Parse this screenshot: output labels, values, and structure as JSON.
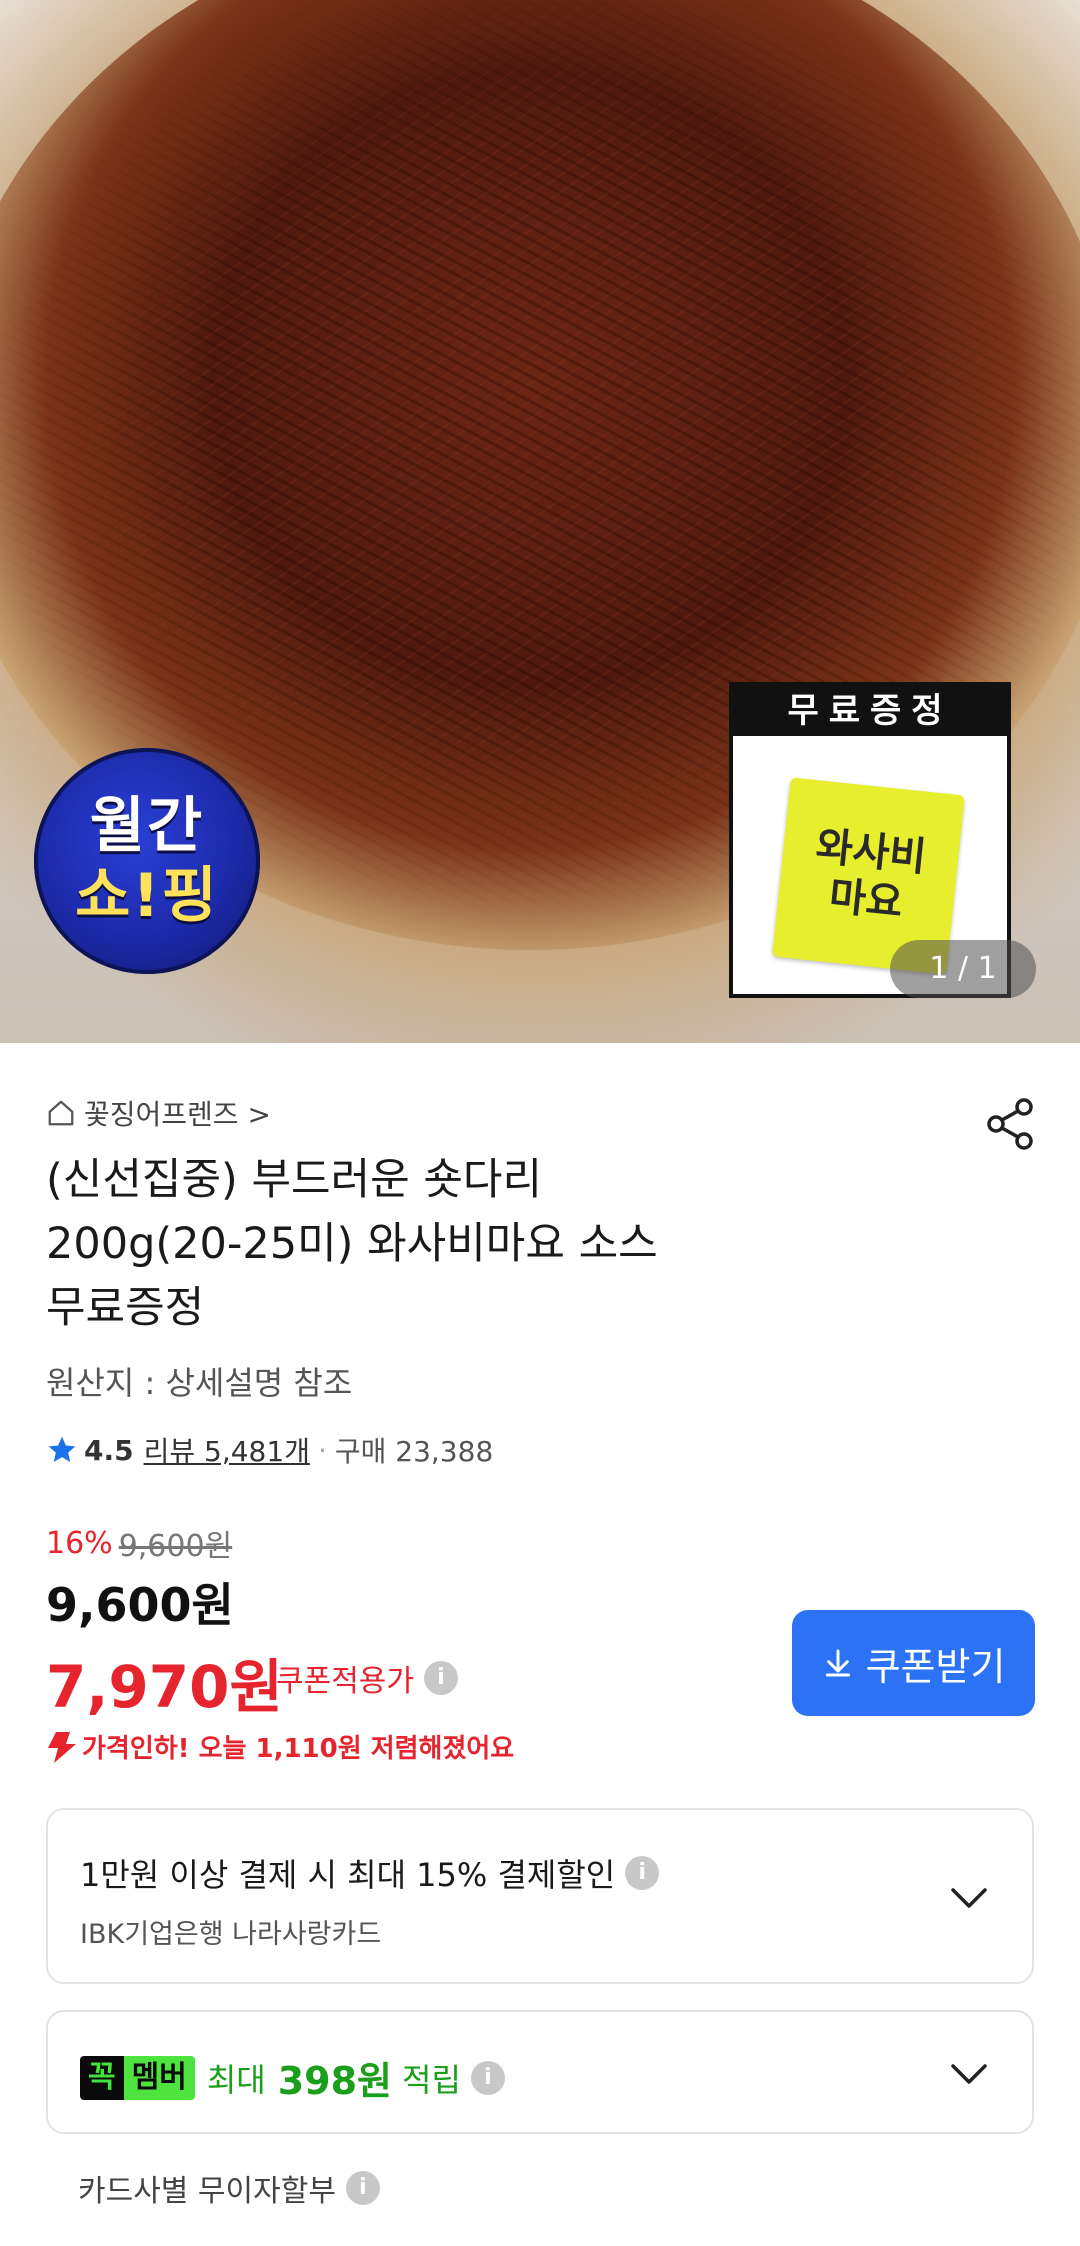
{
  "hero": {
    "badge_line1": "월간",
    "badge_line2": "쇼!핑",
    "gift_title": "무료증정",
    "sachet_line1": "와사비",
    "sachet_line2": "마요",
    "counter": "1 / 1"
  },
  "product": {
    "store": "꽃징어프렌즈 >",
    "title_line1": "(신선집중) 부드러운 숏다리",
    "title_line2": "200g(20-25미) 와사비마요 소스",
    "title_line3": "무료증정",
    "origin": "원산지 : 상세설명 참조",
    "rating": "4.5",
    "review": "리뷰 5,481개",
    "separator": "·",
    "purchases": "구매 23,388"
  },
  "price": {
    "discount_pct": "16%",
    "original": "9,600원",
    "sale": "9,600원",
    "coupon_price": "7,970원",
    "coupon_label": "쿠폰적용가",
    "price_drop": "가격인하! 오늘 1,110원 저렴해졌어요",
    "coupon_button": "쿠폰받기",
    "accent_red": "#e6242d",
    "accent_blue": "#2b72f5"
  },
  "benefits": {
    "card_line1": "1만원 이상 결제 시 최대  15% 결제할인",
    "card_line2": "IBK기업은행 나라사랑카드",
    "member_badge_a": "꼭",
    "member_badge_b": "멤버",
    "member_max": "최대",
    "member_amount": "398원",
    "member_accum": "적립",
    "installment": "카드사별 무이자할부"
  },
  "icons": [
    "home-icon",
    "share-icon",
    "star-icon",
    "info-icon",
    "download-icon",
    "chevron-down-icon",
    "price-down-arrow-icon"
  ]
}
